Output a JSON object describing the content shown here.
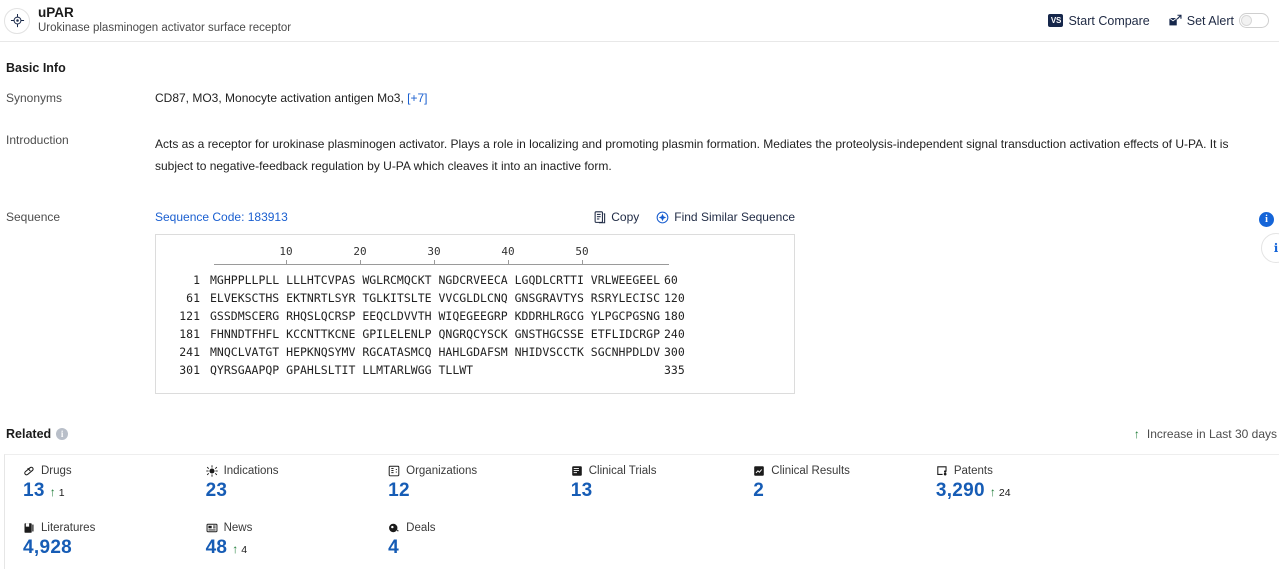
{
  "header": {
    "logo_icon": "target-crosshair-icon",
    "title": "uPAR",
    "subtitle": "Urokinase plasminogen activator surface receptor",
    "start_compare_label": "Start Compare",
    "start_compare_icon": "vs-icon",
    "vs_badge_text": "VS",
    "set_alert_label": "Set Alert",
    "set_alert_icon": "alert-mail-icon",
    "alert_toggle_state": "off"
  },
  "basic_info": {
    "section_title": "Basic Info",
    "synonyms_label": "Synonyms",
    "synonyms_value": "CD87,  MO3,  Monocyte activation antigen Mo3,",
    "synonyms_more": "[+7]",
    "introduction_label": "Introduction",
    "introduction_value": "Acts as a receptor for urokinase plasminogen activator. Plays a role in localizing and promoting plasmin formation. Mediates the proteolysis-independent signal transduction activation effects of U-PA. It is subject to negative-feedback regulation by U-PA which cleaves it into an inactive form."
  },
  "sequence": {
    "label": "Sequence",
    "code_label": "Sequence Code: 183913",
    "copy_label": "Copy",
    "copy_icon": "copy-icon",
    "find_similar_label": "Find Similar Sequence",
    "find_similar_icon": "find-similar-icon",
    "ruler_ticks": [
      "10",
      "20",
      "30",
      "40",
      "50"
    ],
    "lines": [
      {
        "start": "1",
        "blocks": "MGHPPLLPLL LLLHTCVPAS WGLRCMQCKT NGDCRVEECA LGQDLCRTTI VRLWEEGEEL",
        "end": "60"
      },
      {
        "start": "61",
        "blocks": "ELVEKSCTHS EKTNRTLSYR TGLKITSLTE VVCGLDLCNQ GNSGRAVTYS RSRYLECISC",
        "end": "120"
      },
      {
        "start": "121",
        "blocks": "GSSDMSCERG RHQSLQCRSP EEQCLDVVTH WIQEGEEGRP KDDRHLRGCG YLPGCPGSNG",
        "end": "180"
      },
      {
        "start": "181",
        "blocks": "FHNNDTFHFL KCCNTTKCNE GPILELENLP QNGRQCYSCK GNSTHGCSSE ETFLIDCRGP",
        "end": "240"
      },
      {
        "start": "241",
        "blocks": "MNQCLVATGT HEPKNQSYMV RGCATASMCQ HAHLGDAFSM NHIDVSCCTK SGCNHPDLDV",
        "end": "300"
      },
      {
        "start": "301",
        "blocks": "QYRSGAAPQP GPAHLSLTIT LLMTARLWGG TLLWT",
        "end": "335"
      }
    ]
  },
  "related": {
    "title": "Related",
    "info_icon": "info-icon",
    "legend_icon": "up-arrow-icon",
    "legend_label": "Increase in Last 30 days",
    "cards": [
      {
        "label": "Drugs",
        "icon": "capsule-icon",
        "value": "13",
        "delta": "1"
      },
      {
        "label": "Indications",
        "icon": "virus-icon",
        "value": "23",
        "delta": ""
      },
      {
        "label": "Organizations",
        "icon": "building-icon",
        "value": "12",
        "delta": ""
      },
      {
        "label": "Clinical Trials",
        "icon": "clinical-trial-icon",
        "value": "13",
        "delta": ""
      },
      {
        "label": "Clinical Results",
        "icon": "clinical-result-icon",
        "value": "2",
        "delta": ""
      },
      {
        "label": "Patents",
        "icon": "patent-icon",
        "value": "3,290",
        "delta": "24"
      },
      {
        "label": "",
        "icon": "",
        "value": "",
        "delta": ""
      },
      {
        "label": "Literatures",
        "icon": "literature-icon",
        "value": "4,928",
        "delta": ""
      },
      {
        "label": "News",
        "icon": "news-icon",
        "value": "48",
        "delta": "4"
      },
      {
        "label": "Deals",
        "icon": "deal-icon",
        "value": "4",
        "delta": ""
      }
    ]
  },
  "side_widgets": {
    "badge_text": "i",
    "badge_icon": "info-badge-icon",
    "circle_icon": "info-circle-icon"
  },
  "colors": {
    "accent_blue": "#165cb5",
    "link_blue": "#1a5fd0",
    "increase_green": "#1a7a34",
    "navy": "#16274b"
  }
}
